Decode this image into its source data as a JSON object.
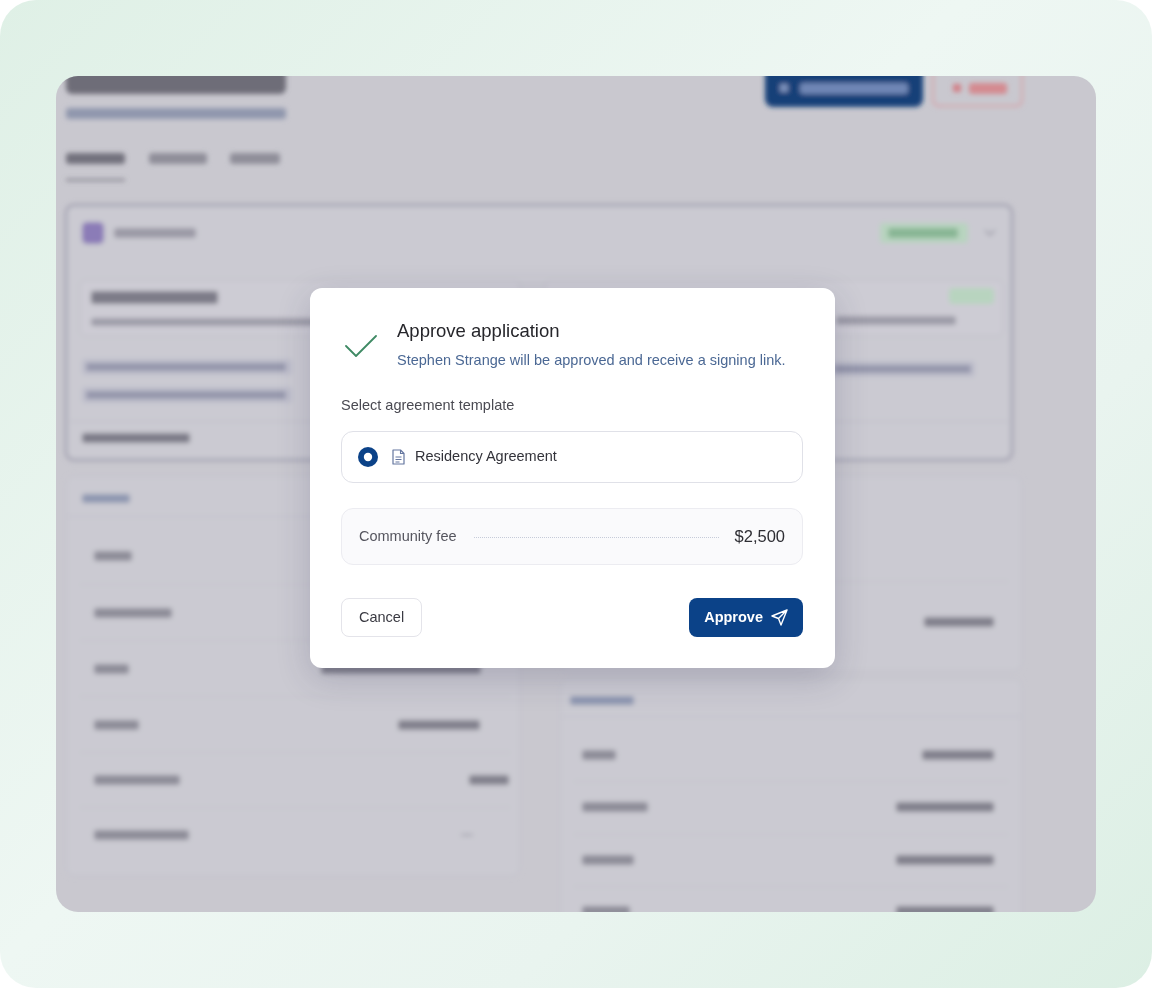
{
  "dialog": {
    "title": "Approve application",
    "message": "Stephen Strange will be approved and receive a signing link.",
    "template_label": "Select agreement template",
    "templates": [
      {
        "label": "Residency Agreement",
        "selected": true
      }
    ],
    "fee": {
      "label": "Community fee",
      "amount": "$2,500"
    },
    "buttons": [
      {
        "label": "Cancel",
        "kind": "secondary"
      },
      {
        "label": "Approve",
        "kind": "primary"
      }
    ]
  }
}
